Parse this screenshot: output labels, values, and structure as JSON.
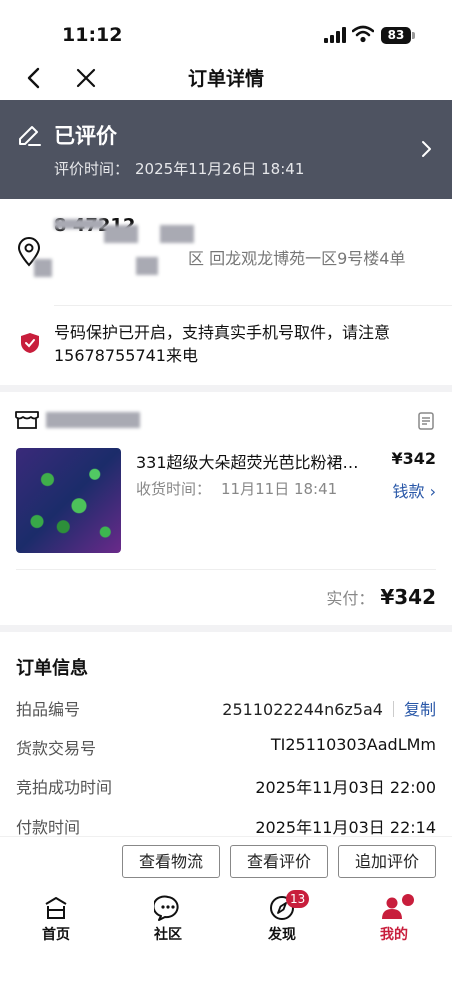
{
  "status_bar": {
    "time": "11:12",
    "battery": "83"
  },
  "nav": {
    "title": "订单详情",
    "back_icon": "chevron-left-icon",
    "close_icon": "close-icon"
  },
  "banner": {
    "title": "已评价",
    "time_label": "评价时间：",
    "time_value": "2025年11月26日 18:41",
    "background": "#4e5361"
  },
  "address": {
    "name_visible": "8 47212",
    "address_visible": "区 回龙观龙博苑一区9号楼4单",
    "privacy_text": "号码保护已开启，支持真实手机号取件，请注意15678755741来电"
  },
  "shop": {
    "product_title": "331超级大朵超荧光芭比粉裙…",
    "price": "¥342",
    "receive_label": "收货时间：",
    "receive_time": "11月11日 18:41",
    "payment_link": "钱款",
    "actual_label": "实付：",
    "actual_amount": "¥342"
  },
  "order_info": {
    "title": "订单信息",
    "rows": [
      {
        "label": "拍品编号",
        "value": "2511022244n6z5a4",
        "action": "复制"
      },
      {
        "label": "货款交易号",
        "value": "TI25110303AadLMm"
      },
      {
        "label": "竞拍成功时间",
        "value": "2025年11月03日 22:00"
      },
      {
        "label": "付款时间",
        "value": "2025年11月03日 22:14"
      }
    ]
  },
  "actions": {
    "logistics": "查看物流",
    "review": "查看评价",
    "add_review": "追加评价"
  },
  "tabbar": {
    "items": [
      {
        "label": "首页",
        "icon": "home-icon"
      },
      {
        "label": "社区",
        "icon": "chat-icon"
      },
      {
        "label": "发现",
        "icon": "compass-icon",
        "badge": "13"
      },
      {
        "label": "我的",
        "icon": "user-icon"
      }
    ],
    "active_color": "#c81e3c"
  }
}
